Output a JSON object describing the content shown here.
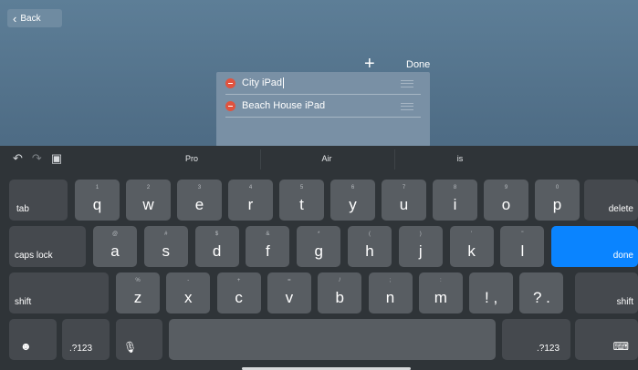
{
  "nav": {
    "back_label": "Back"
  },
  "toolbar": {
    "add_symbol": "+",
    "done_label": "Done"
  },
  "devices": [
    {
      "name": "City iPad"
    },
    {
      "name": "Beach House iPad"
    }
  ],
  "predictions": {
    "items": [
      "Pro",
      "Air",
      "is"
    ]
  },
  "keyboard": {
    "row1": [
      {
        "main": "q",
        "alt": "1"
      },
      {
        "main": "w",
        "alt": "2"
      },
      {
        "main": "e",
        "alt": "3"
      },
      {
        "main": "r",
        "alt": "4"
      },
      {
        "main": "t",
        "alt": "5"
      },
      {
        "main": "y",
        "alt": "6"
      },
      {
        "main": "u",
        "alt": "7"
      },
      {
        "main": "i",
        "alt": "8"
      },
      {
        "main": "o",
        "alt": "9"
      },
      {
        "main": "p",
        "alt": "0"
      }
    ],
    "row2": [
      {
        "main": "a",
        "alt": "@"
      },
      {
        "main": "s",
        "alt": "#"
      },
      {
        "main": "d",
        "alt": "$"
      },
      {
        "main": "f",
        "alt": "&"
      },
      {
        "main": "g",
        "alt": "*"
      },
      {
        "main": "h",
        "alt": "("
      },
      {
        "main": "j",
        "alt": ")"
      },
      {
        "main": "k",
        "alt": "'"
      },
      {
        "main": "l",
        "alt": "\""
      }
    ],
    "row3": [
      {
        "main": "z",
        "alt": "%"
      },
      {
        "main": "x",
        "alt": "-"
      },
      {
        "main": "c",
        "alt": "+"
      },
      {
        "main": "v",
        "alt": "="
      },
      {
        "main": "b",
        "alt": "/"
      },
      {
        "main": "n",
        "alt": ";"
      },
      {
        "main": "m",
        "alt": ":"
      },
      {
        "main": "! ,",
        "alt": ""
      },
      {
        "main": "? .",
        "alt": ""
      }
    ],
    "tab_label": "tab",
    "delete_label": "delete",
    "caps_label": "caps lock",
    "done_label": "done",
    "shift_label": "shift",
    "numbers_label": ".?123",
    "emoji_icon": "emoji-icon",
    "mic_icon": "microphone-icon",
    "hide_icon": "keyboard-dismiss-icon"
  },
  "colors": {
    "accent": "#0a84ff",
    "delete_red": "#e0533f"
  }
}
